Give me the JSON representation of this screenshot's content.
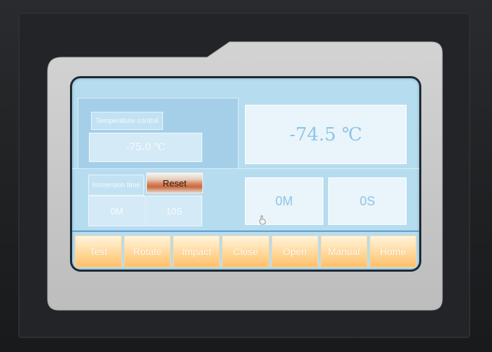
{
  "colors": {
    "screen_bg": "#b6dcef",
    "value_text": "#8fc4e4",
    "nav_gradient_top": "#fff4dd",
    "nav_gradient_bottom": "#ffc06b",
    "reset_accent": "#d9825a"
  },
  "temperature": {
    "label": "Temperature control",
    "setpoint": "-75.0 ℃",
    "current": "-74.5 ℃"
  },
  "immersion": {
    "label": "Immersion time",
    "reset_label": "Reset",
    "minutes_set": "0M",
    "seconds_set": "10S",
    "minutes_elapsed": "0M",
    "seconds_elapsed": "0S"
  },
  "nav": {
    "test": "Test",
    "rotate": "Rotate",
    "impact": "Impact",
    "close": "Close",
    "open": "Open",
    "manual": "Manual",
    "home": "Home"
  }
}
